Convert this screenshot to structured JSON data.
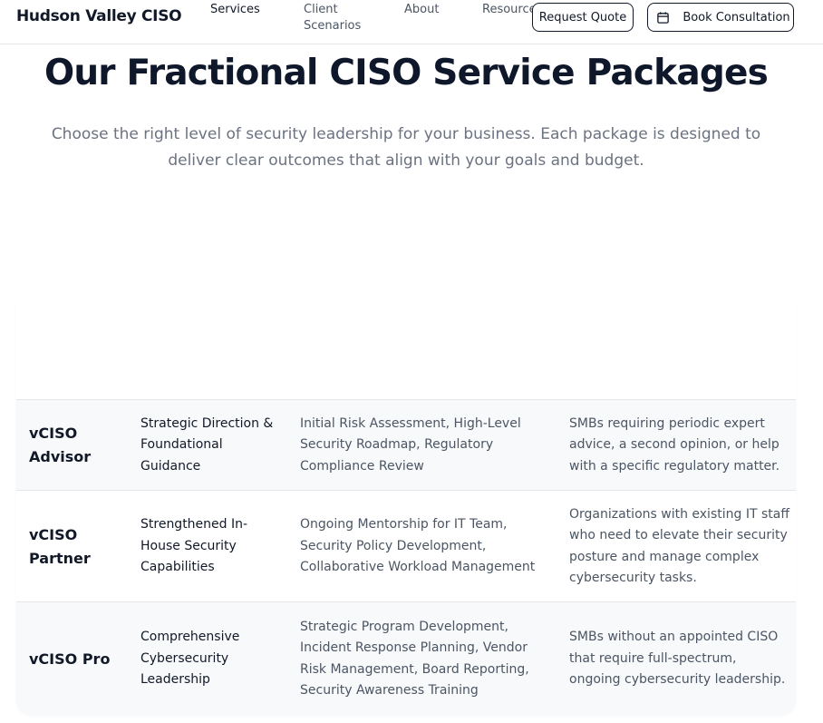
{
  "nav": {
    "brand": "Hudson Valley CISO",
    "links": [
      "Services",
      "Client Scenarios",
      "About",
      "Resource"
    ],
    "quote_button": "Request Quote",
    "book_button": "Book Consultation"
  },
  "hero": {
    "title": "Our Fractional CISO Service Packages",
    "subtitle": "Choose the right level of security leadership for your business. Each package is designed to deliver clear outcomes that align with your goals and budget."
  },
  "packages": [
    {
      "name": "vCISO Advisor",
      "focus": "Strategic Direction & Foundational Guidance",
      "services": "Initial Risk Assessment, High-Level Security Roadmap, Regulatory Compliance Review",
      "ideal_for": "SMBs requiring periodic expert advice, a second opinion, or help with a specific regulatory matter."
    },
    {
      "name": "vCISO Partner",
      "focus": "Strengthened In-House Security Capabilities",
      "services": "Ongoing Mentorship for IT Team, Security Policy Development, Collaborative Workload Management",
      "ideal_for": "Organizations with existing IT staff who need to elevate their security posture and manage complex cybersecurity tasks."
    },
    {
      "name": "vCISO Pro",
      "focus": "Comprehensive Cybersecurity Leadership",
      "services": "Strategic Program Development, Incident Response Planning, Vendor Risk Management, Board Reporting, Security Awareness Training",
      "ideal_for": "SMBs without an appointed CISO that require full-spectrum, ongoing cybersecurity leadership."
    }
  ],
  "icons": {
    "book_button_icon": "calendar-icon"
  }
}
